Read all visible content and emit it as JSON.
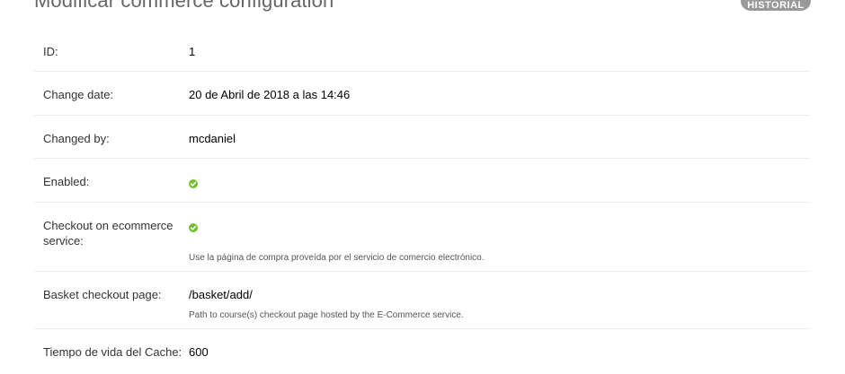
{
  "header": {
    "title": "Modificar commerce configuration",
    "history_button": "HISTORIAL"
  },
  "fields": [
    {
      "label": "ID:",
      "value": "1"
    },
    {
      "label": "Change date:",
      "value": "20 de Abril de 2018 a las 14:46"
    },
    {
      "label": "Changed by:",
      "value": "mcdaniel"
    },
    {
      "label": "Enabled:",
      "value_icon": "check-circle-icon",
      "value_color": "#70bf2b"
    },
    {
      "label": "Checkout on ecommerce service:",
      "value_icon": "check-circle-icon",
      "value_color": "#70bf2b",
      "help": "Use la página de compra proveída por el servicio de comercio electrónico."
    },
    {
      "label": "Basket checkout page:",
      "value": "/basket/add/",
      "help": "Path to course(s) checkout page hosted by the E-Commerce service."
    },
    {
      "label": "Tiempo de vida del Cache:",
      "value": "600"
    }
  ]
}
